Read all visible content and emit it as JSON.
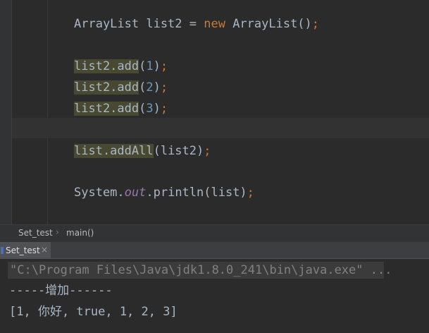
{
  "editor": {
    "line1": {
      "decl": "ArrayList list2 = ",
      "kw_new": "new",
      "ctor": " ArrayList()",
      "semi": ";"
    },
    "add_calls": [
      {
        "call": "list2.add",
        "open": "(",
        "arg": "1",
        "close": ")",
        "semi": ";"
      },
      {
        "call": "list2.add",
        "open": "(",
        "arg": "2",
        "close": ")",
        "semi": ";"
      },
      {
        "call": "list2.add",
        "open": "(",
        "arg": "3",
        "close": ")",
        "semi": ";"
      }
    ],
    "add_all": {
      "call": "list.addAll",
      "args": "(list2)",
      "semi": ";"
    },
    "println": {
      "cls": "System.",
      "field": "out",
      "method": ".println(list)",
      "semi": ";"
    }
  },
  "breadcrumb": {
    "class_name": "Set_test",
    "separator": "›",
    "method": "main()"
  },
  "run_panel": {
    "tab_label": "Set_test",
    "close_glyph": "×",
    "command": "\"C:\\Program Files\\Java\\jdk1.8.0_241\\bin\\java.exe\" ...",
    "output": [
      "-----增加------",
      "[1, 你好, true, 1, 2, 3]"
    ]
  },
  "colors": {
    "background": "#2b2b2b",
    "keyword": "#cc7832",
    "number": "#6897bb",
    "field": "#9876aa",
    "text": "#a9b7c6",
    "highlight": "#494931"
  }
}
